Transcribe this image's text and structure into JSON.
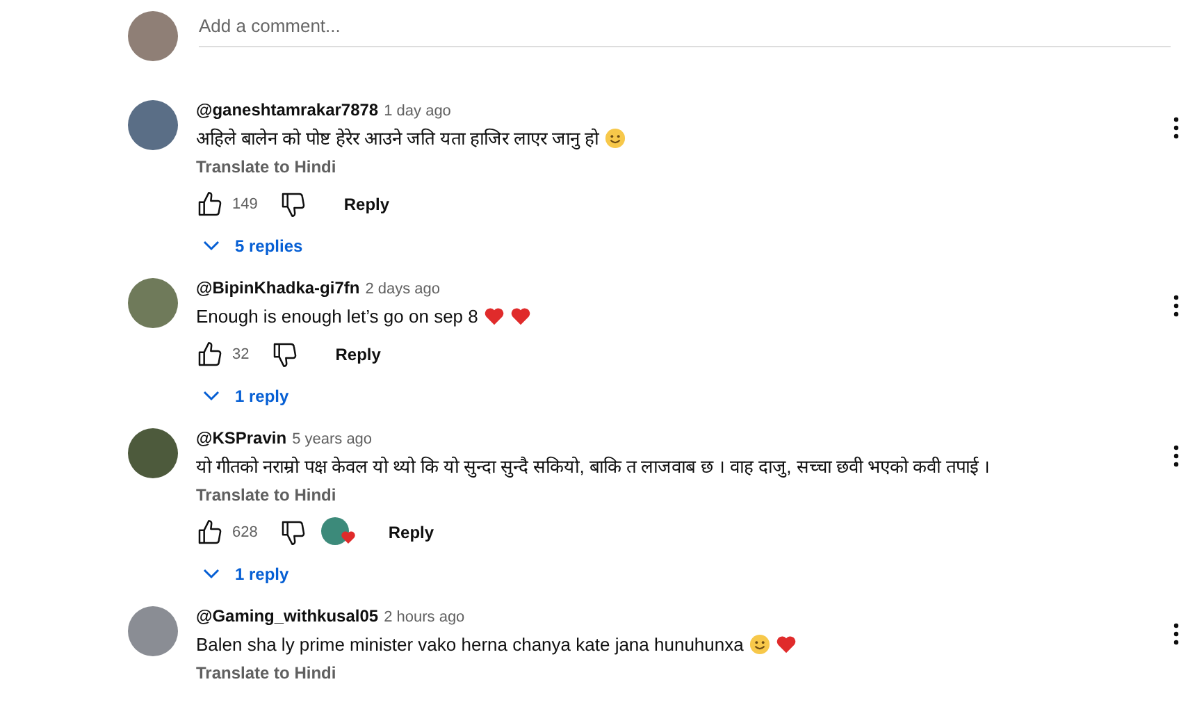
{
  "add_comment": {
    "placeholder": "Add a comment..."
  },
  "comments": [
    {
      "author": "@ganeshtamrakar7878",
      "time": "1 day ago",
      "text": "अहिले बालेन को पोष्ट हेरेर आउने जति यता हाजिर लाएर जानु हो",
      "emojis": [
        {
          "kind": "smile"
        }
      ],
      "translate": "Translate to Hindi",
      "likes": "149",
      "creator_heart": false,
      "reply": "Reply",
      "replies": "5 replies"
    },
    {
      "author": "@BipinKhadka-gi7fn",
      "time": "2 days ago",
      "text": "Enough is enough let’s go on sep 8",
      "emojis": [
        {
          "kind": "heart"
        },
        {
          "kind": "heart"
        }
      ],
      "likes": "32",
      "creator_heart": false,
      "reply": "Reply",
      "replies": "1 reply"
    },
    {
      "author": "@KSPravin",
      "time": "5 years ago",
      "text": "यो गीतको नराम्रो पक्ष केवल यो थ्यो कि यो सुन्दा सुन्दै सकियो, बाकि त लाजवाब छ । वाह दाजु, सच्चा छवी भएको कवी तपाई ।",
      "translate": "Translate to Hindi",
      "likes": "628",
      "creator_heart": true,
      "reply": "Reply",
      "replies": "1 reply"
    },
    {
      "author": "@Gaming_withkusal05",
      "time": "2 hours ago",
      "text": "Balen sha ly prime minister vako herna chanya kate jana hunuhunxa",
      "emojis": [
        {
          "kind": "smile"
        },
        {
          "kind": "heart"
        }
      ],
      "translate": "Translate to Hindi"
    }
  ]
}
